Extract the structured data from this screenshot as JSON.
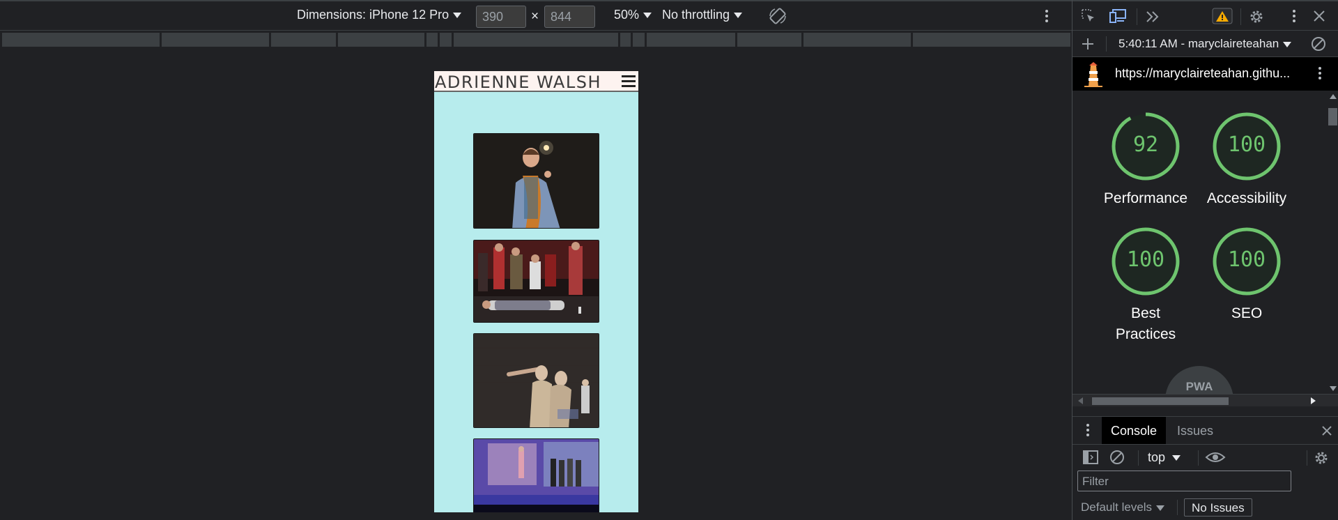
{
  "device_toolbar": {
    "dimensions_label": "Dimensions: iPhone 12 Pro",
    "width": "390",
    "times": "×",
    "height": "844",
    "zoom": "50%",
    "throttling": "No throttling"
  },
  "phone": {
    "brand": "ADRIENNE WALSH",
    "photos": [
      "stage-photo-1",
      "stage-photo-2",
      "stage-photo-3",
      "stage-photo-4"
    ]
  },
  "lighthouse": {
    "time_and_user": "5:40:11 AM - maryclaireteahan",
    "url": "https://maryclaireteahan.githu...",
    "scores": [
      {
        "score": "92",
        "label": "Performance",
        "value": 0.92
      },
      {
        "score": "100",
        "label": "Accessibility",
        "value": 1.0
      },
      {
        "score": "100",
        "label": "Best Practices",
        "label_line1": "Best",
        "label_line2": "Practices",
        "value": 1.0
      },
      {
        "score": "100",
        "label": "SEO",
        "value": 1.0
      }
    ],
    "pwa": "PWA",
    "score_color": "#6ec46e"
  },
  "console_drawer": {
    "tabs": [
      "Console",
      "Issues"
    ],
    "context": "top",
    "filter_placeholder": "Filter",
    "levels": "Default levels",
    "no_issues": "No Issues"
  }
}
